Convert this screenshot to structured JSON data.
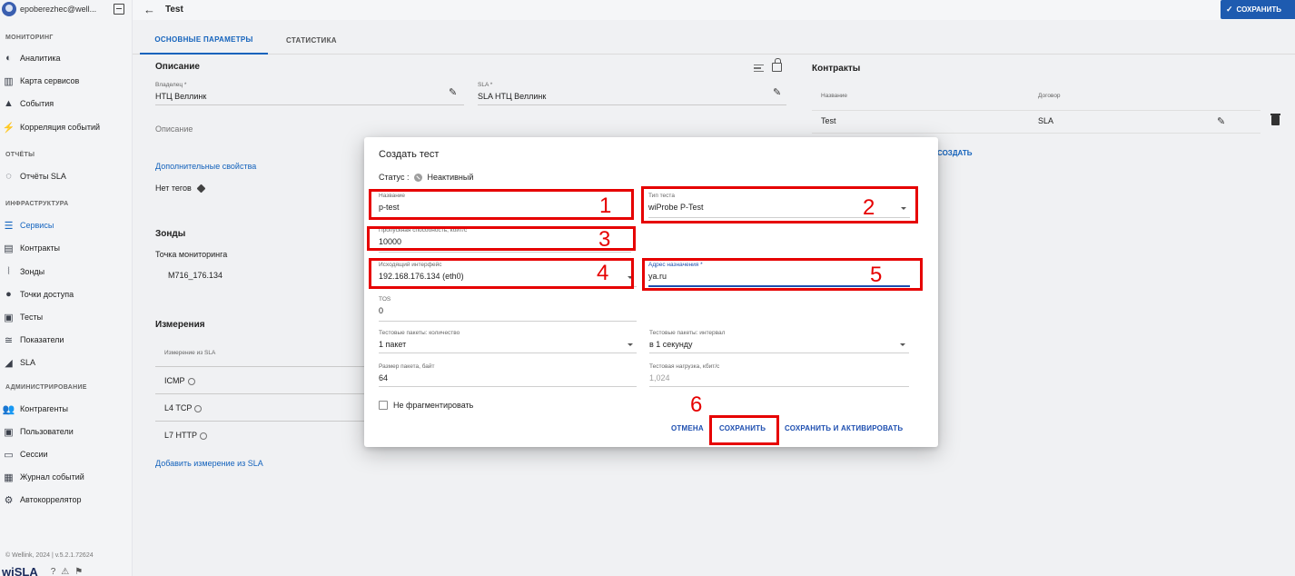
{
  "sidebar": {
    "user_email": "epoberezhec@well...",
    "sections": {
      "monitoring": "МОНИТОРИНГ",
      "reports": "ОТЧЁТЫ",
      "infrastructure": "ИНФРАСТРУКТУРА",
      "admin": "АДМИНИСТРИРОВАНИЕ"
    },
    "items": {
      "analytics": "Аналитика",
      "service_map": "Карта сервисов",
      "events": "События",
      "event_correlation": "Корреляция событий",
      "sla_reports": "Отчёты SLA",
      "services": "Сервисы",
      "contracts": "Контракты",
      "probes": "Зонды",
      "access_points": "Точки доступа",
      "tests": "Тесты",
      "metrics": "Показатели",
      "sla": "SLA",
      "counterparties": "Контрагенты",
      "users": "Пользователи",
      "sessions": "Сессии",
      "event_log": "Журнал событий",
      "autocorrelator": "Автокоррелятор"
    },
    "version": "© Wellink, 2024 | v.5.2.1.72624",
    "brand": "wiSLA"
  },
  "topbar": {
    "title": "Test",
    "save_label": "СОХРАНИТЬ"
  },
  "tabs": {
    "main": "ОСНОВНЫЕ ПАРАМЕТРЫ",
    "stats": "СТАТИСТИКА"
  },
  "description": {
    "title": "Описание",
    "owner_label": "Владелец *",
    "owner_value": "НТЦ Веллинк",
    "sla_label": "SLA *",
    "sla_value": "SLA НТЦ Веллинк",
    "description_placeholder": "Описание",
    "extra_props": "Дополнительные свойства",
    "no_tags": "Нет тегов"
  },
  "probes": {
    "title": "Зонды",
    "monitoring_point": "Точка мониторинга",
    "point_value": "M716_176.134"
  },
  "measurements": {
    "title": "Измерения",
    "column": "Измерение из SLA",
    "rows": [
      "ICMP",
      "L4 TCP",
      "L7 HTTP"
    ],
    "add_link": "Добавить измерение из SLA"
  },
  "contracts": {
    "title": "Контракты",
    "col_name": "Название",
    "col_contract": "Договор",
    "row_name": "Test",
    "row_contract": "SLA",
    "create": "СОЗДАТЬ"
  },
  "dialog": {
    "title": "Создать тест",
    "status_label": "Статус :",
    "status_value": "Неактивный",
    "name_label": "Название",
    "name_value": "p-test",
    "type_label": "Тип теста",
    "type_value": "wiProbe P-Test",
    "bandwidth_label": "Пропускная способность, кбит/с",
    "bandwidth_value": "10000",
    "src_iface_label": "Исходящий интерфейс",
    "src_iface_value": "192.168.176.134 (eth0)",
    "dest_label": "Адрес назначения *",
    "dest_value": "ya.ru",
    "tos_label": "TOS",
    "tos_value": "0",
    "pkt_count_label": "Тестовые пакеты: количество",
    "pkt_count_value": "1 пакет",
    "pkt_interval_label": "Тестовые пакеты: интервал",
    "pkt_interval_value": "в 1 секунду",
    "pkt_size_label": "Размер пакета, байт",
    "pkt_size_value": "64",
    "load_label": "Тестовая нагрузка, кбит/с",
    "load_value": "1,024",
    "no_fragment": "Не фрагментировать",
    "cancel": "ОТМЕНА",
    "save": "СОХРАНИТЬ",
    "save_activate": "СОХРАНИТЬ И АКТИВИРОВАТЬ"
  },
  "annotations": [
    "1",
    "2",
    "3",
    "4",
    "5",
    "6"
  ],
  "colors": {
    "accent": "#1e5bb0",
    "annotation": "#e60000"
  }
}
